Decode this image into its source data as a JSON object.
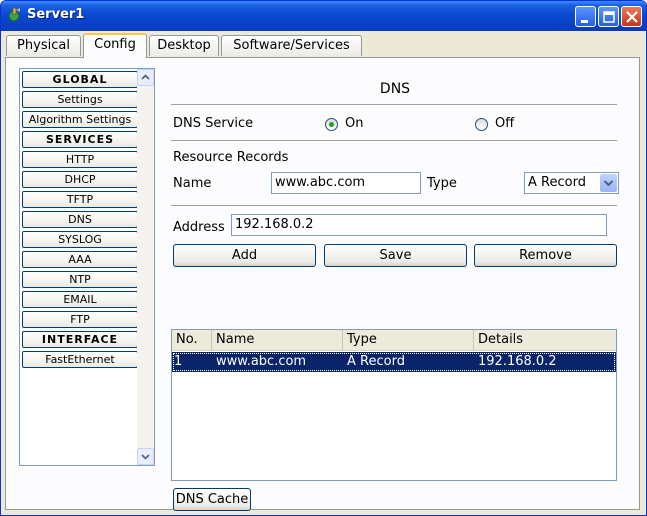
{
  "window": {
    "title": "Server1"
  },
  "tabs": [
    {
      "label": "Physical"
    },
    {
      "label": "Config"
    },
    {
      "label": "Desktop"
    },
    {
      "label": "Software/Services"
    }
  ],
  "sidebar": {
    "items": [
      {
        "label": "GLOBAL"
      },
      {
        "label": "Settings"
      },
      {
        "label": "Algorithm Settings"
      },
      {
        "label": "SERVICES"
      },
      {
        "label": "HTTP"
      },
      {
        "label": "DHCP"
      },
      {
        "label": "TFTP"
      },
      {
        "label": "DNS"
      },
      {
        "label": "SYSLOG"
      },
      {
        "label": "AAA"
      },
      {
        "label": "NTP"
      },
      {
        "label": "EMAIL"
      },
      {
        "label": "FTP"
      },
      {
        "label": "INTERFACE"
      },
      {
        "label": "FastEthernet"
      }
    ]
  },
  "dns": {
    "title": "DNS",
    "service_label": "DNS Service",
    "on_label": "On",
    "off_label": "Off",
    "resource_records_label": "Resource Records",
    "name_label": "Name",
    "name_value": "www.abc.com",
    "type_label": "Type",
    "type_value": "A Record",
    "address_label": "Address",
    "address_value": "192.168.0.2",
    "add_label": "Add",
    "save_label": "Save",
    "remove_label": "Remove",
    "dns_cache_label": "DNS Cache",
    "table": {
      "headers": [
        "No.",
        "Name",
        "Type",
        "Details"
      ],
      "rows": [
        [
          "1",
          "www.abc.com",
          "A Record",
          "192.168.0.2"
        ]
      ]
    }
  },
  "colors": {
    "selection": "#0a246a",
    "titlebar": "#0a47d0",
    "radio_on": "#21a121"
  }
}
